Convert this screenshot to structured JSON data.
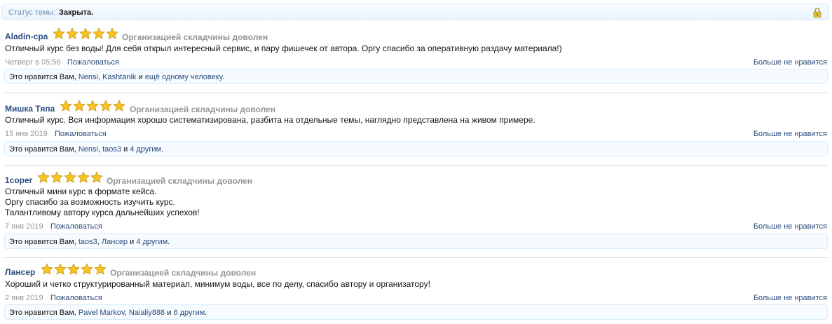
{
  "thread_status": {
    "label": "Статус темы:",
    "value": "Закрыта.",
    "icon": "lock-icon"
  },
  "colors": {
    "link": "#2b4c7e",
    "muted": "#969696",
    "star": "#f7c320",
    "box_border": "#d7edfc"
  },
  "posts": [
    {
      "username": "Aladin-cpa",
      "stars": 5,
      "rating_text": "Организацией складчины доволен",
      "message": [
        "Отличный курс без воды! Для себя открыл интересный сервис, и пару фишечек от автора. Оргу спасибо за оперативную раздачу материала!)"
      ],
      "date": "Четверг в 05:56",
      "complain": "Пожаловаться",
      "unlike": "Больше не нравится",
      "likes": {
        "prefix": "Это нравится Вам,",
        "user1": "Nensi",
        "sep": ",",
        "user2": "Kashtanik",
        "conj": "и",
        "more": "ещё одному человеку",
        "end": "."
      }
    },
    {
      "username": "Мишка Тяпа",
      "stars": 5,
      "rating_text": "Организацией складчины доволен",
      "message": [
        "Отличный курс. Вся информация хорошо систематизирована, разбита на отдельные темы, наглядно представлена на живом примере."
      ],
      "date": "15 янв 2019",
      "complain": "Пожаловаться",
      "unlike": "Больше не нравится",
      "likes": {
        "prefix": "Это нравится Вам,",
        "user1": "Nensi",
        "sep": ",",
        "user2": "taos3",
        "conj": "и",
        "more": "4 другим",
        "end": "."
      }
    },
    {
      "username": "1coper",
      "stars": 5,
      "rating_text": "Организацией складчины доволен",
      "message": [
        "Отличный мини курс в формате кейса.",
        "Оргу спасибо за возможность изучить курс.",
        "Талантливому автору курса дальнейших успехов!"
      ],
      "date": "7 янв 2019",
      "complain": "Пожаловаться",
      "unlike": "Больше не нравится",
      "likes": {
        "prefix": "Это нравится Вам,",
        "user1": "taos3",
        "sep": ",",
        "user2": "Лансер",
        "conj": "и",
        "more": "4 другим",
        "end": "."
      }
    },
    {
      "username": "Лансер",
      "stars": 5,
      "rating_text": "Организацией складчины доволен",
      "message": [
        "Хороший и четко структурированный материал, минимум воды, все по делу, спасибо автору и организатору!"
      ],
      "date": "2 янв 2019",
      "complain": "Пожаловаться",
      "unlike": "Больше не нравится",
      "likes": {
        "prefix": "Это нравится Вам,",
        "user1": "Pavel Markov",
        "sep": ",",
        "user2": "Naialiy888",
        "conj": "и",
        "more": "6 другим",
        "end": "."
      }
    }
  ]
}
